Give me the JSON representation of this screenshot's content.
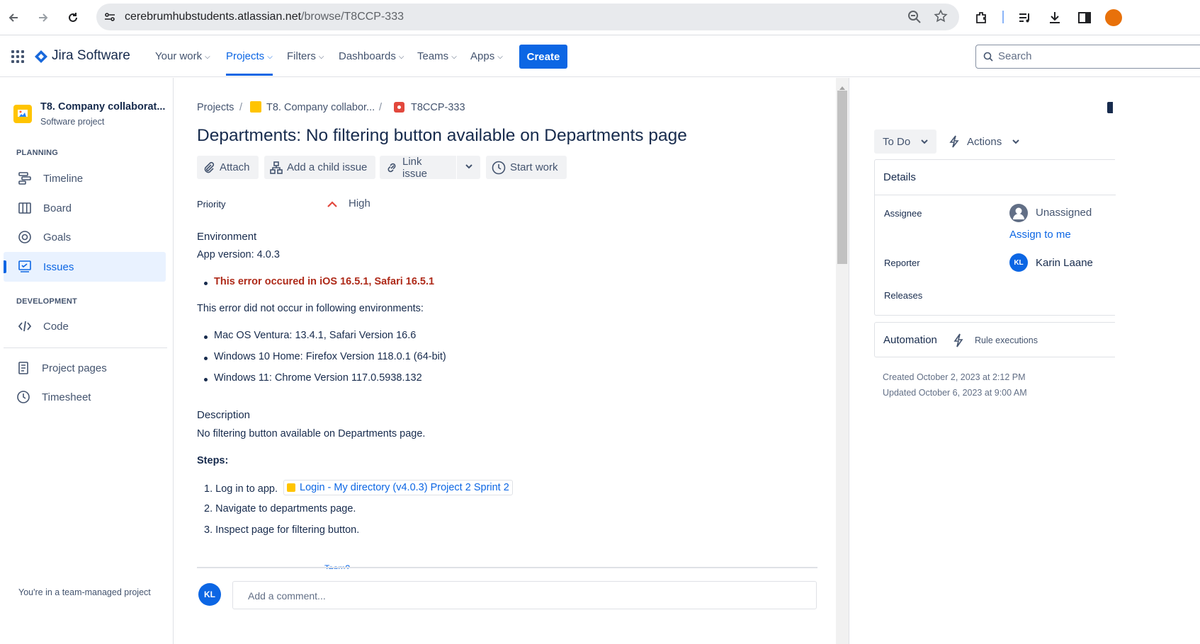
{
  "browser": {
    "url_host": "cerebrumhubstudents.atlassian.net",
    "url_path": "/browse/T8CCP-333"
  },
  "nav": {
    "product": "Jira Software",
    "items": [
      "Your work",
      "Projects",
      "Filters",
      "Dashboards",
      "Teams",
      "Apps"
    ],
    "active": "Projects",
    "create": "Create",
    "search_placeholder": "Search"
  },
  "sidebar": {
    "project_name": "T8. Company collaborat...",
    "project_type": "Software project",
    "planning_heading": "PLANNING",
    "planning_items": [
      "Timeline",
      "Board",
      "Goals",
      "Issues"
    ],
    "selected": "Issues",
    "development_heading": "DEVELOPMENT",
    "development_items": [
      "Code"
    ],
    "other_items": [
      "Project pages",
      "Timesheet"
    ],
    "footer": "You're in a team-managed project"
  },
  "issue": {
    "breadcrumb": [
      "Projects",
      "T8. Company collabor...",
      "T8CCP-333"
    ],
    "title": "Departments: No filtering button available on Departments page",
    "toolbar": {
      "attach": "Attach",
      "add_child": "Add a child issue",
      "link": "Link issue",
      "start_work": "Start work"
    },
    "priority_label": "Priority",
    "priority_value": "High",
    "environment_heading": "Environment",
    "app_version": "App version: 4.0.3",
    "error_line": "This error occured in iOS 16.5.1, Safari 16.5.1",
    "not_occur_intro": "This error did not occur in following environments:",
    "not_occur_envs": [
      "Mac OS Ventura: 13.4.1, Safari Version 16.6",
      "Windows 10 Home: Firefox Version 118.0.1 (64-bit)",
      "Windows 11: Chrome Version 117.0.5938.132"
    ],
    "description_heading": "Description",
    "description_text": "No filtering button available on Departments page.",
    "steps_heading": "Steps:",
    "steps": [
      {
        "num": "1.",
        "text": "Log in to app."
      },
      {
        "num": "2.",
        "text": "Navigate to departments page."
      },
      {
        "num": "3.",
        "text": "Inspect page for filtering button."
      }
    ],
    "step1_link": "Login - My directory (v4.0.3) Project 2 Sprint 2",
    "partial_tag": "Team?",
    "comment_placeholder": "Add a comment...",
    "commenter_initials": "KL"
  },
  "details": {
    "status": "To Do",
    "actions": "Actions",
    "heading": "Details",
    "assignee_label": "Assignee",
    "assignee_value": "Unassigned",
    "assign_to_me": "Assign to me",
    "reporter_label": "Reporter",
    "reporter_initials": "KL",
    "reporter_value": "Karin Laane",
    "releases_label": "Releases",
    "automation_heading": "Automation",
    "rule_executions": "Rule executions",
    "created": "Created October 2, 2023 at 2:12 PM",
    "updated": "Updated October 6, 2023 at 9:00 AM"
  },
  "colors": {
    "brand_blue": "#0c66e4",
    "error_red": "#ae2a19",
    "priority_orange": "#e2483d"
  }
}
